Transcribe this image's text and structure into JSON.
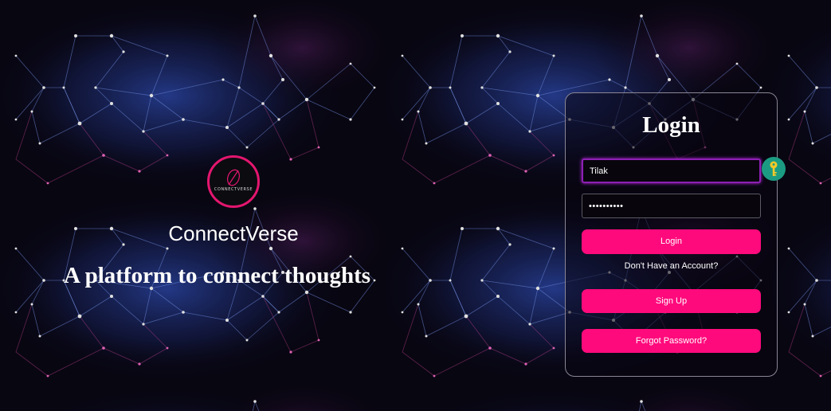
{
  "brand": {
    "logo_text": "CONNECTVERSE",
    "name": "ConnectVerse",
    "tagline": "A platform to connect thoughts"
  },
  "login": {
    "title": "Login",
    "username_value": "Tilak",
    "password_value": "••••••••••",
    "login_label": "Login",
    "no_account_text": "Don't Have an Account?",
    "signup_label": "Sign Up",
    "forgot_label": "Forgot Password?"
  },
  "icons": {
    "key_badge": "key-icon",
    "logo": "connectverse-logo-icon"
  },
  "colors": {
    "accent_pink": "#ff0a7c",
    "logo_ring": "#e4166f",
    "key_badge": "#1b9c82",
    "focus_border": "#8e1fb5"
  }
}
